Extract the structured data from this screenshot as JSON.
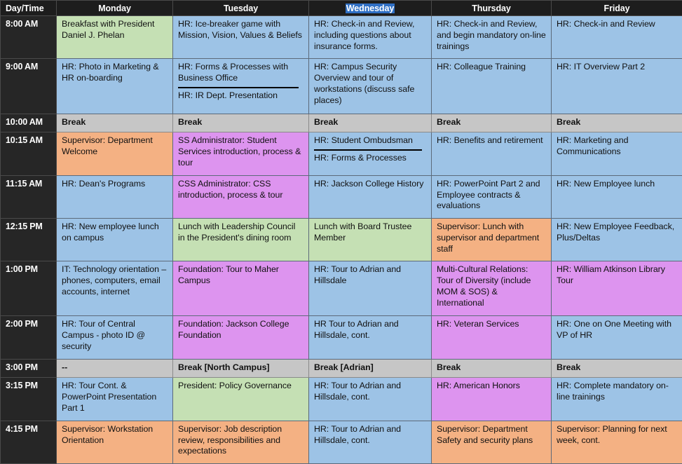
{
  "table": {
    "columns": [
      {
        "key": "time",
        "label": "Day/Time",
        "highlighted": false
      },
      {
        "key": "mon",
        "label": "Monday",
        "highlighted": false
      },
      {
        "key": "tue",
        "label": "Tuesday",
        "highlighted": false
      },
      {
        "key": "wed",
        "label": "Wednesday",
        "highlighted": true
      },
      {
        "key": "thu",
        "label": "Thursday",
        "highlighted": false
      },
      {
        "key": "fri",
        "label": "Friday",
        "highlighted": false
      }
    ],
    "colors": {
      "blue": "#9dc3e6",
      "green": "#c5e0b4",
      "orange": "#f4b183",
      "purple": "#dd94ef",
      "gray": "#c6c6c6",
      "header_background": "#1d1d1d",
      "header_text": "#ffffff",
      "selection_highlight": "#2f6fc4"
    },
    "rows": [
      {
        "time": "8:00 AM",
        "cells": [
          {
            "text": "Breakfast with President Daniel J. Phelan",
            "color": "green"
          },
          {
            "text": "HR:  Ice-breaker game with Mission, Vision, Values & Beliefs",
            "color": "blue"
          },
          {
            "text": "HR:  Check-in and Review, including questions about insurance forms.",
            "color": "blue"
          },
          {
            "text": "HR:  Check-in and Review, and begin mandatory on-line trainings",
            "color": "blue"
          },
          {
            "text": "HR:  Check-in and Review",
            "color": "blue"
          }
        ]
      },
      {
        "time": "9:00 AM",
        "cells": [
          {
            "text": "HR: Photo in Marketing & HR on-boarding",
            "color": "blue"
          },
          {
            "text": "HR:  Forms & Processes with Business Office",
            "text2": "HR: IR Dept. Presentation",
            "color": "blue",
            "split": true
          },
          {
            "text": "HR:  Campus Security Overview and tour of workstations (discuss safe places)",
            "color": "blue"
          },
          {
            "text": "HR:  Colleague Training",
            "color": "blue"
          },
          {
            "text": "HR:  IT Overview Part 2",
            "color": "blue"
          }
        ]
      },
      {
        "time": "10:00 AM",
        "cells": [
          {
            "text": "Break",
            "color": "gray",
            "break": true
          },
          {
            "text": "Break",
            "color": "gray",
            "break": true
          },
          {
            "text": "Break",
            "color": "gray",
            "break": true
          },
          {
            "text": "Break",
            "color": "gray",
            "break": true
          },
          {
            "text": "Break",
            "color": "gray",
            "break": true
          }
        ]
      },
      {
        "time": "10:15 AM",
        "cells": [
          {
            "text": "Supervisor:  Department Welcome",
            "color": "orange"
          },
          {
            "text": "SS Administrator: Student Services introduction, process & tour",
            "color": "purple"
          },
          {
            "text": "HR:  Student Ombudsman",
            "text2": "HR: Forms & Processes",
            "color": "blue",
            "split": true
          },
          {
            "text": "HR:  Benefits and retirement",
            "color": "blue"
          },
          {
            "text": "HR: Marketing and Communications",
            "color": "blue"
          }
        ]
      },
      {
        "time": "11:15 AM",
        "cells": [
          {
            "text": "HR:  Dean's Programs",
            "color": "blue"
          },
          {
            "text": "CSS Administrator: CSS introduction, process & tour",
            "color": "purple"
          },
          {
            "text": "HR:  Jackson College History",
            "color": "blue"
          },
          {
            "text": "HR: PowerPoint Part 2 and Employee contracts & evaluations",
            "color": "blue"
          },
          {
            "text": "HR: New Employee lunch",
            "color": "blue"
          }
        ]
      },
      {
        "time": "12:15 PM",
        "cells": [
          {
            "text": "HR: New employee lunch on campus",
            "color": "blue"
          },
          {
            "text": "Lunch with Leadership Council in the President's dining room",
            "color": "green"
          },
          {
            "text": "Lunch with Board Trustee Member",
            "color": "green"
          },
          {
            "text": "Supervisor: Lunch with supervisor and department staff",
            "color": "orange"
          },
          {
            "text": "HR: New Employee Feedback, Plus/Deltas",
            "color": "blue"
          }
        ]
      },
      {
        "time": "1:00 PM",
        "cells": [
          {
            "text": "IT: Technology orientation – phones, computers, email accounts, internet",
            "color": "blue"
          },
          {
            "text": "Foundation: Tour to Maher Campus",
            "color": "purple"
          },
          {
            "text": "HR: Tour to Adrian and Hillsdale",
            "color": "blue"
          },
          {
            "text": "Multi-Cultural Relations: Tour of Diversity (include MOM & SOS) & International",
            "color": "purple"
          },
          {
            "text": "HR:  William Atkinson Library Tour",
            "color": "purple"
          }
        ]
      },
      {
        "time": "2:00 PM",
        "cells": [
          {
            "text": "HR: Tour of Central Campus - photo ID @ security",
            "color": "blue"
          },
          {
            "text": "Foundation: Jackson College Foundation",
            "color": "purple"
          },
          {
            "text": "HR Tour to Adrian and Hillsdale, cont.",
            "color": "blue"
          },
          {
            "text": "HR:  Veteran Services",
            "color": "purple"
          },
          {
            "text": "HR:  One on One Meeting with VP of HR",
            "color": "blue"
          }
        ]
      },
      {
        "time": "3:00 PM",
        "cells": [
          {
            "text": "--",
            "color": "gray",
            "break": true
          },
          {
            "text": "Break [North Campus]",
            "color": "gray",
            "break": true
          },
          {
            "text": "Break [Adrian]",
            "color": "gray",
            "break": true
          },
          {
            "text": "Break",
            "color": "gray",
            "break": true
          },
          {
            "text": "Break",
            "color": "gray",
            "break": true
          }
        ]
      },
      {
        "time": "3:15 PM",
        "cells": [
          {
            "text": "HR: Tour Cont. & PowerPoint Presentation Part 1",
            "color": "blue"
          },
          {
            "text": "President: Policy Governance",
            "color": "green"
          },
          {
            "text": "HR: Tour to Adrian and Hillsdale, cont.",
            "color": "blue"
          },
          {
            "text": "HR:  American Honors",
            "color": "purple"
          },
          {
            "text": "HR:  Complete mandatory on-line trainings",
            "color": "blue"
          }
        ]
      },
      {
        "time": "4:15 PM",
        "cells": [
          {
            "text": "Supervisor:  Workstation Orientation",
            "color": "orange"
          },
          {
            "text": "Supervisor: Job description review, responsibilities and expectations",
            "color": "orange"
          },
          {
            "text": "HR: Tour to Adrian and Hillsdale, cont.",
            "color": "blue"
          },
          {
            "text": "Supervisor: Department Safety and security plans",
            "color": "orange"
          },
          {
            "text": "Supervisor: Planning for next week, cont.",
            "color": "orange"
          }
        ]
      }
    ]
  }
}
